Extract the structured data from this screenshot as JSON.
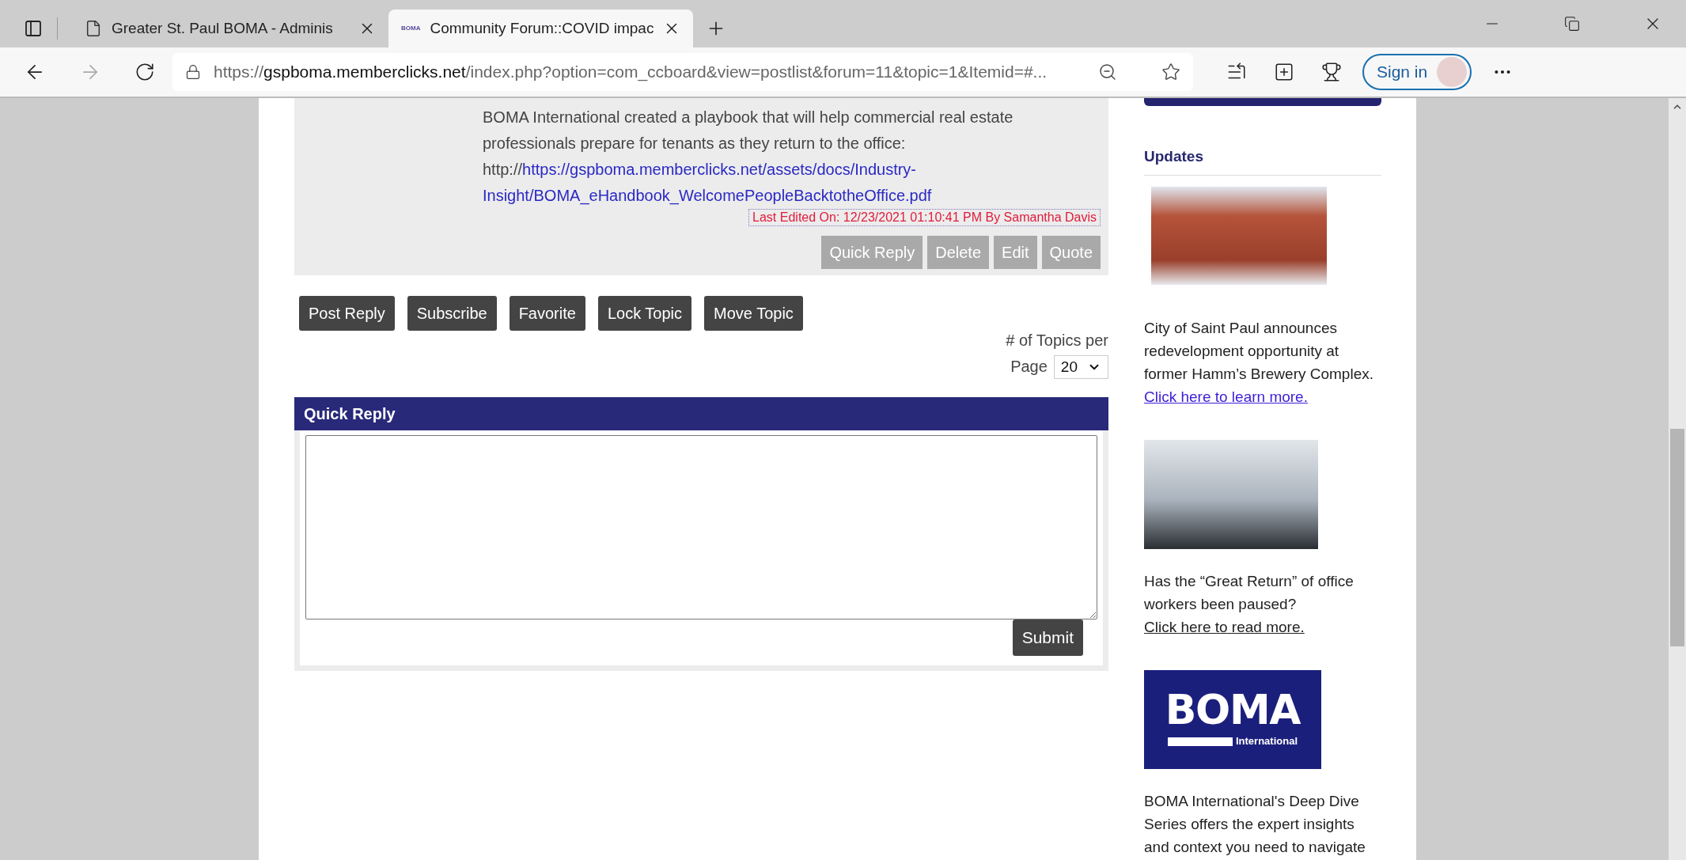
{
  "browser": {
    "tabs": [
      {
        "title": "Greater St. Paul BOMA - Adminis",
        "selected": false,
        "kind": "page"
      },
      {
        "title": "Community Forum::COVID impac",
        "selected": true,
        "kind": "site"
      }
    ],
    "favicon_text": "BOMA",
    "url": {
      "scheme": "https://",
      "host": "gspboma.memberclicks.net",
      "path": "/index.php?option=com_ccboard&view=postlist&forum=11&topic=1&Itemid=#..."
    },
    "sign_in": "Sign in"
  },
  "post": {
    "body": "BOMA International created a playbook that will help commercial real estate professionals prepare for tenants as they return to the office:",
    "url_prefix": "http://",
    "link_lines": [
      "https://gspboma.memberclicks.net/assets/docs/Industry-",
      "Insight/BOMA_eHandbook_WelcomePeopleBacktotheOffice.pdf"
    ],
    "edited": "Last Edited On: 12/23/2021 01:10:41 PM By Samantha Davis",
    "actions": [
      "Quick Reply",
      "Delete",
      "Edit",
      "Quote"
    ]
  },
  "topic_buttons": [
    "Post Reply",
    "Subscribe",
    "Favorite",
    "Lock Topic",
    "Move Topic"
  ],
  "per_page": {
    "label_lines": [
      "# of Topics per",
      "Page"
    ],
    "value": "20"
  },
  "quick_reply": {
    "title": "Quick Reply",
    "submit": "Submit"
  },
  "sidebar": {
    "heading": "Updates",
    "items": [
      {
        "kind": "building-photo",
        "text": "City of Saint Paul announces redevelopment opportunity at former Hamm’s Brewery Complex.",
        "link": "Click here to learn more. "
      },
      {
        "kind": "office-photo",
        "text": "Has the “Great Return” of office workers been paused?",
        "link": "Click here to read more."
      },
      {
        "kind": "logo",
        "logo": {
          "word": "BOMA",
          "sub": "International"
        },
        "text": "BOMA International's Deep Dive Series offers the expert insights and context you need to navigate"
      }
    ]
  }
}
